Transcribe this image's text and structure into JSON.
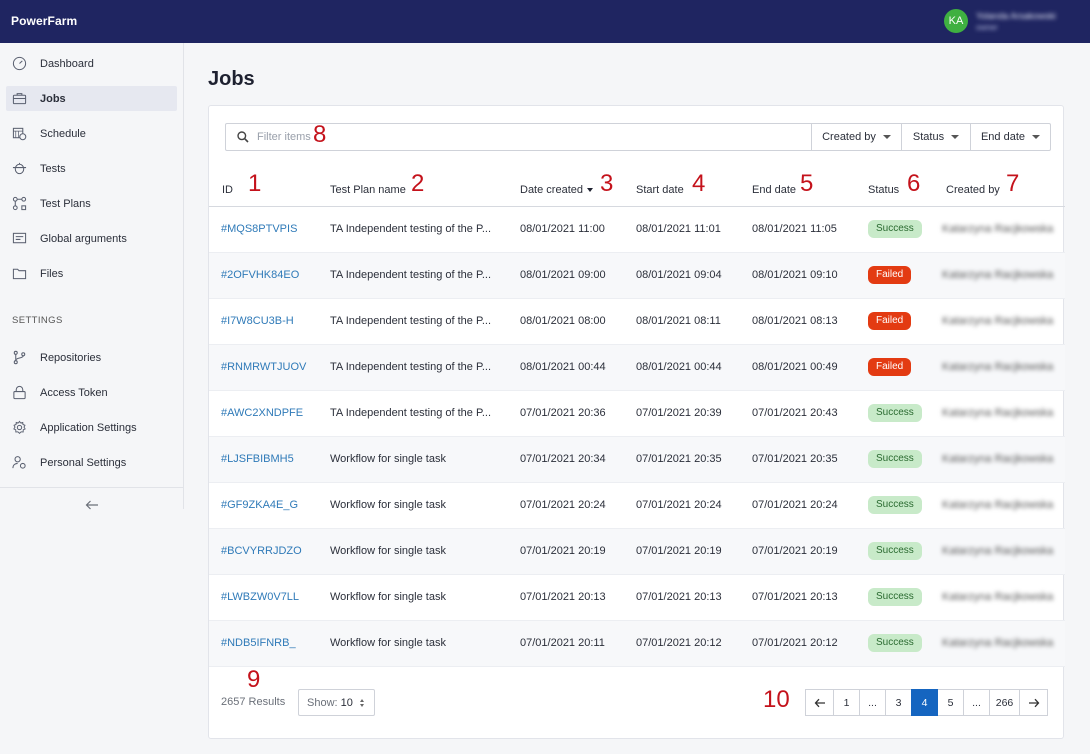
{
  "app": {
    "brand": "PowerFarm"
  },
  "user": {
    "initials": "KA",
    "name": "Yolanda Arsakowski",
    "role": "owner"
  },
  "sidebar": {
    "items": [
      {
        "label": "Dashboard",
        "icon": "dashboard-icon"
      },
      {
        "label": "Jobs",
        "icon": "briefcase-icon",
        "active": true
      },
      {
        "label": "Schedule",
        "icon": "calendar-clock-icon"
      },
      {
        "label": "Tests",
        "icon": "test-icon"
      },
      {
        "label": "Test Plans",
        "icon": "test-plans-icon"
      },
      {
        "label": "Global arguments",
        "icon": "arguments-icon"
      },
      {
        "label": "Files",
        "icon": "folder-icon"
      }
    ],
    "settings_title": "SETTINGS",
    "settings_items": [
      {
        "label": "Repositories",
        "icon": "repository-icon"
      },
      {
        "label": "Access Token",
        "icon": "lock-icon"
      },
      {
        "label": "Application Settings",
        "icon": "gear-icon"
      },
      {
        "label": "Personal Settings",
        "icon": "user-settings-icon"
      }
    ],
    "collapse_icon": "arrow-left-icon"
  },
  "page": {
    "title": "Jobs"
  },
  "filter": {
    "placeholder": "Filter items",
    "dropdowns": [
      "Created by",
      "Status",
      "End date"
    ]
  },
  "table": {
    "headers": {
      "id": "ID",
      "plan": "Test Plan name",
      "date_created": "Date created",
      "start": "Start date",
      "end": "End date",
      "status": "Status",
      "created_by": "Created by"
    },
    "rows": [
      {
        "id": "#MQS8PTVPIS",
        "plan": "TA Independent testing of the P...",
        "date_created": "08/01/2021 11:00",
        "start": "08/01/2021 11:01",
        "end": "08/01/2021 11:05",
        "status": "Success",
        "created_by": "Katarzyna Racjkowska"
      },
      {
        "id": "#2OFVHK84EO",
        "plan": "TA Independent testing of the P...",
        "date_created": "08/01/2021 09:00",
        "start": "08/01/2021 09:04",
        "end": "08/01/2021 09:10",
        "status": "Failed",
        "created_by": "Katarzyna Racjkowska"
      },
      {
        "id": "#I7W8CU3B-H",
        "plan": "TA Independent testing of the P...",
        "date_created": "08/01/2021 08:00",
        "start": "08/01/2021 08:11",
        "end": "08/01/2021 08:13",
        "status": "Failed",
        "created_by": "Katarzyna Racjkowska"
      },
      {
        "id": "#RNMRWTJUOV",
        "plan": "TA Independent testing of the P...",
        "date_created": "08/01/2021 00:44",
        "start": "08/01/2021 00:44",
        "end": "08/01/2021 00:49",
        "status": "Failed",
        "created_by": "Katarzyna Racjkowska"
      },
      {
        "id": "#AWC2XNDPFE",
        "plan": "TA Independent testing of the P...",
        "date_created": "07/01/2021 20:36",
        "start": "07/01/2021 20:39",
        "end": "07/01/2021 20:43",
        "status": "Success",
        "created_by": "Katarzyna Racjkowska"
      },
      {
        "id": "#LJSFBIBMH5",
        "plan": "Workflow for single task",
        "date_created": "07/01/2021 20:34",
        "start": "07/01/2021 20:35",
        "end": "07/01/2021 20:35",
        "status": "Success",
        "created_by": "Katarzyna Racjkowska"
      },
      {
        "id": "#GF9ZKA4E_G",
        "plan": "Workflow for single task",
        "date_created": "07/01/2021 20:24",
        "start": "07/01/2021 20:24",
        "end": "07/01/2021 20:24",
        "status": "Success",
        "created_by": "Katarzyna Racjkowska"
      },
      {
        "id": "#BCVYRRJDZO",
        "plan": "Workflow for single task",
        "date_created": "07/01/2021 20:19",
        "start": "07/01/2021 20:19",
        "end": "07/01/2021 20:19",
        "status": "Success",
        "created_by": "Katarzyna Racjkowska"
      },
      {
        "id": "#LWBZW0V7LL",
        "plan": "Workflow for single task",
        "date_created": "07/01/2021 20:13",
        "start": "07/01/2021 20:13",
        "end": "07/01/2021 20:13",
        "status": "Success",
        "created_by": "Katarzyna Racjkowska"
      },
      {
        "id": "#NDB5IFNRB_",
        "plan": "Workflow for single task",
        "date_created": "07/01/2021 20:11",
        "start": "07/01/2021 20:12",
        "end": "07/01/2021 20:12",
        "status": "Success",
        "created_by": "Katarzyna Racjkowska"
      }
    ]
  },
  "footer": {
    "results": "2657 Results",
    "show_label": "Show:",
    "show_value": "10",
    "pages": [
      "1",
      "...",
      "3",
      "4",
      "5",
      "...",
      "266"
    ],
    "active_page": "4"
  },
  "annotations": {
    "a1": "1",
    "a2": "2",
    "a3": "3",
    "a4": "4",
    "a5": "5",
    "a6": "6",
    "a7": "7",
    "a8": "8",
    "a9": "9",
    "a10": "10"
  }
}
